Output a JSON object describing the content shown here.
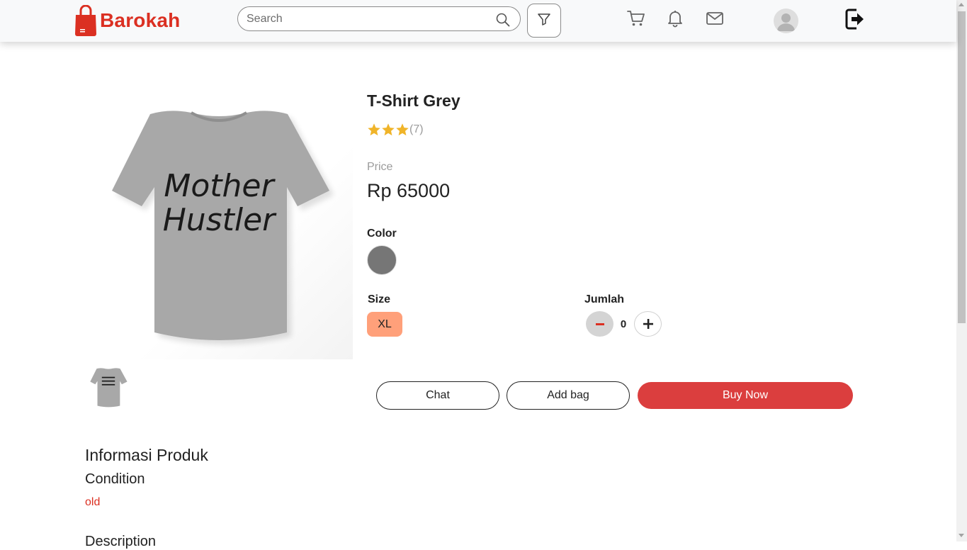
{
  "header": {
    "brand": "Barokah",
    "search_placeholder": "Search",
    "brand_color": "#db3022",
    "icons": [
      "shopping-bag-icon",
      "search-icon",
      "filter-icon",
      "cart-icon",
      "bell-icon",
      "mail-icon",
      "avatar-icon",
      "logout-icon"
    ]
  },
  "product": {
    "title": "T-Shirt Grey",
    "rating": 3,
    "rating_count": "(7)",
    "price_label": "Price",
    "price": "Rp 65000",
    "color_label": "Color",
    "color_value": "#767676",
    "size_label": "Size",
    "size_value": "XL",
    "qty_label": "Jumlah",
    "qty_value": "0",
    "shirt_print_line1": "Mother",
    "shirt_print_line2": "Hustler"
  },
  "actions": {
    "chat_label": "Chat",
    "bag_label": "Add bag",
    "buy_label": "Buy Now",
    "buy_color": "#db3e3e"
  },
  "info": {
    "title": "Informasi Produk",
    "condition_title": "Condition",
    "condition_value": "old",
    "description_title": "Description"
  }
}
